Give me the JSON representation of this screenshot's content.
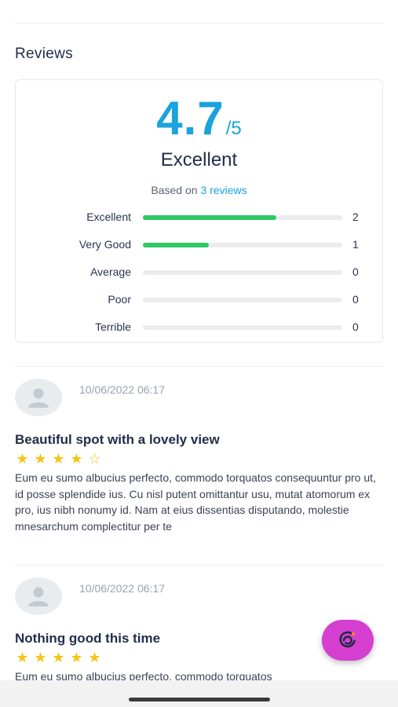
{
  "reviews_section": {
    "title": "Reviews",
    "score": "4.7",
    "score_suffix": "/5",
    "verdict": "Excellent",
    "based_on_prefix": "Based on",
    "based_on_count": "3 reviews",
    "distribution": [
      {
        "label": "Excellent",
        "count": "2",
        "fraction": 0.67
      },
      {
        "label": "Very Good",
        "count": "1",
        "fraction": 0.33
      },
      {
        "label": "Average",
        "count": "0",
        "fraction": 0
      },
      {
        "label": "Poor",
        "count": "0",
        "fraction": 0
      },
      {
        "label": "Terrible",
        "count": "0",
        "fraction": 0
      }
    ],
    "colors": {
      "accent": "#1aa3dc",
      "bar": "#2ec866",
      "star": "#f6c416",
      "fab": "#d43fd0"
    }
  },
  "reviews": [
    {
      "date": "10/06/2022 06:17",
      "title": "Beautiful spot with a lovely view",
      "rating": 4,
      "body": "Eum eu sumo albucius perfecto, commodo torquatos consequuntur pro ut, id posse splendide ius. Cu nisl putent omittantur usu, mutat atomorum ex pro, ius nibh nonumy id. Nam at eius dissentias disputando, molestie mnesarchum complectitur per te"
    },
    {
      "date": "10/06/2022 06:17",
      "title": "Nothing good this time",
      "rating": 5,
      "body": "Eum eu sumo albucius perfecto, commodo torquatos"
    }
  ],
  "icons": {
    "avatar": "user-icon",
    "fab": "chat-swirl-icon"
  }
}
